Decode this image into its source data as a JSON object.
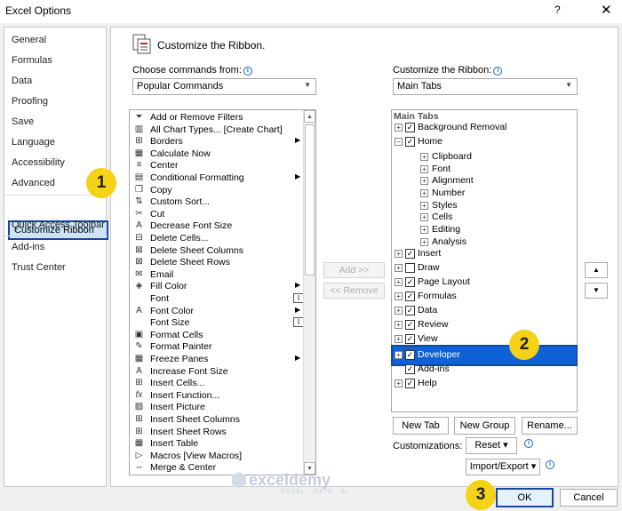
{
  "window": {
    "title": "Excel Options",
    "help": "?",
    "close": "✕"
  },
  "sidebar": {
    "items": [
      "General",
      "Formulas",
      "Data",
      "Proofing",
      "Save",
      "Language",
      "Accessibility",
      "Advanced",
      "Customize Ribbon",
      "Quick Access Toolbar",
      "Add-ins",
      "Trust Center"
    ],
    "selected": "Customize Ribbon"
  },
  "header": {
    "title": "Customize the Ribbon."
  },
  "left": {
    "label": "Choose commands from:",
    "dropdown_value": "Popular Commands",
    "commands": [
      "Add or Remove Filters",
      "All Chart Types... [Create Chart]",
      "Borders",
      "Calculate Now",
      "Center",
      "Conditional Formatting",
      "Copy",
      "Custom Sort...",
      "Cut",
      "Decrease Font Size",
      "Delete Cells...",
      "Delete Sheet Columns",
      "Delete Sheet Rows",
      "Email",
      "Fill Color",
      "Font",
      "Font Color",
      "Font Size",
      "Format Cells",
      "Format Painter",
      "Freeze Panes",
      "Increase Font Size",
      "Insert Cells...",
      "Insert Function...",
      "Insert Picture",
      "Insert Sheet Columns",
      "Insert Sheet Rows",
      "Insert Table",
      "Macros [View Macros]",
      "Merge & Center"
    ]
  },
  "middle": {
    "add": "Add >>",
    "remove": "<< Remove"
  },
  "right": {
    "label": "Customize the Ribbon:",
    "dropdown_value": "Main Tabs",
    "tree_header": "Main Tabs",
    "tree": [
      "Background Removal",
      "Home",
      "Clipboard",
      "Font",
      "Alignment",
      "Number",
      "Styles",
      "Cells",
      "Editing",
      "Analysis",
      "Insert",
      "Draw",
      "Page Layout",
      "Formulas",
      "Data",
      "Review",
      "View",
      "Developer",
      "Add-ins",
      "Help"
    ],
    "new_tab": "New Tab",
    "new_group": "New Group",
    "rename": "Rename...",
    "customizations_label": "Customizations:",
    "reset": "Reset ▾",
    "import_export": "Import/Export ▾"
  },
  "footer": {
    "ok": "OK",
    "cancel": "Cancel"
  },
  "badges": [
    "1",
    "2",
    "3"
  ],
  "watermark": {
    "brand": "exceldemy",
    "sub": "EXCEL · DATA · BI"
  },
  "colors": {
    "selection_border": "#1747a6",
    "highlight": "#0f62d6",
    "badge": "#f5d215"
  }
}
